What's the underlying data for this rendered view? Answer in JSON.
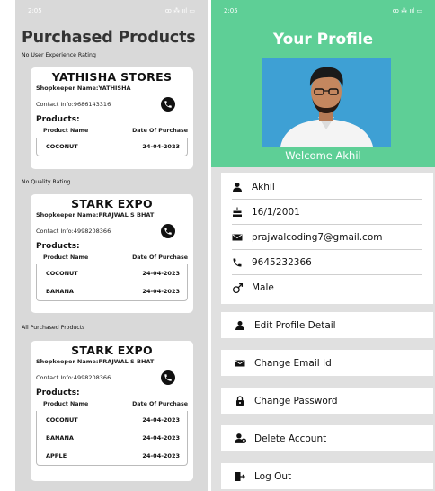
{
  "left": {
    "status_time": "2:05",
    "status_icons": "ꝏ ⁂ ııl ▭",
    "title": "Purchased Products",
    "shops": [
      {
        "rating": "No User Experience Rating",
        "name": "YATHISHA STORES",
        "keeper": "Shopkeeper Name:YATHISHA",
        "contact": "Contact Info:9686143316",
        "products_label": "Products:",
        "col_name": "Product Name",
        "col_date": "Date Of Purchase",
        "products": [
          {
            "name": "COCONUT",
            "date": "24-04-2023"
          }
        ]
      },
      {
        "rating": "No Quality Rating",
        "name": "STARK EXPO",
        "keeper": "Shopkeeper Name:PRAJWAL S BHAT",
        "contact": "Contact Info:4998208366",
        "products_label": "Products:",
        "col_name": "Product Name",
        "col_date": "Date Of Purchase",
        "products": [
          {
            "name": "COCONUT",
            "date": "24-04-2023"
          },
          {
            "name": "BANANA",
            "date": "24-04-2023"
          }
        ]
      },
      {
        "rating": "All Purchased Products",
        "name": "STARK EXPO",
        "keeper": "Shopkeeper Name:PRAJWAL S BHAT",
        "contact": "Contact Info:4998208366",
        "products_label": "Products:",
        "col_name": "Product Name",
        "col_date": "Date Of Purchase",
        "products": [
          {
            "name": "COCONUT",
            "date": "24-04-2023"
          },
          {
            "name": "BANANA",
            "date": "24-04-2023"
          },
          {
            "name": "APPLE",
            "date": "24-04-2023"
          }
        ]
      }
    ]
  },
  "right": {
    "status_time": "2:05",
    "status_icons": "ꝏ ⁂ ııl ▭",
    "title": "Your Profile",
    "welcome": "Welcome Akhil",
    "info": {
      "name": "Akhil",
      "dob": "16/1/2001",
      "email": "prajwalcoding7@gmail.com",
      "phone": "9645232366",
      "gender": "Male"
    },
    "actions": {
      "edit": "Edit Profile Detail",
      "email": "Change Email Id",
      "password": "Change Password",
      "delete": "Delete Account",
      "logout": "Log Out"
    }
  },
  "colors": {
    "accent_green": "#5ecf96",
    "left_bg": "#d9d9d9",
    "photo_bg": "#3ea0d4"
  }
}
